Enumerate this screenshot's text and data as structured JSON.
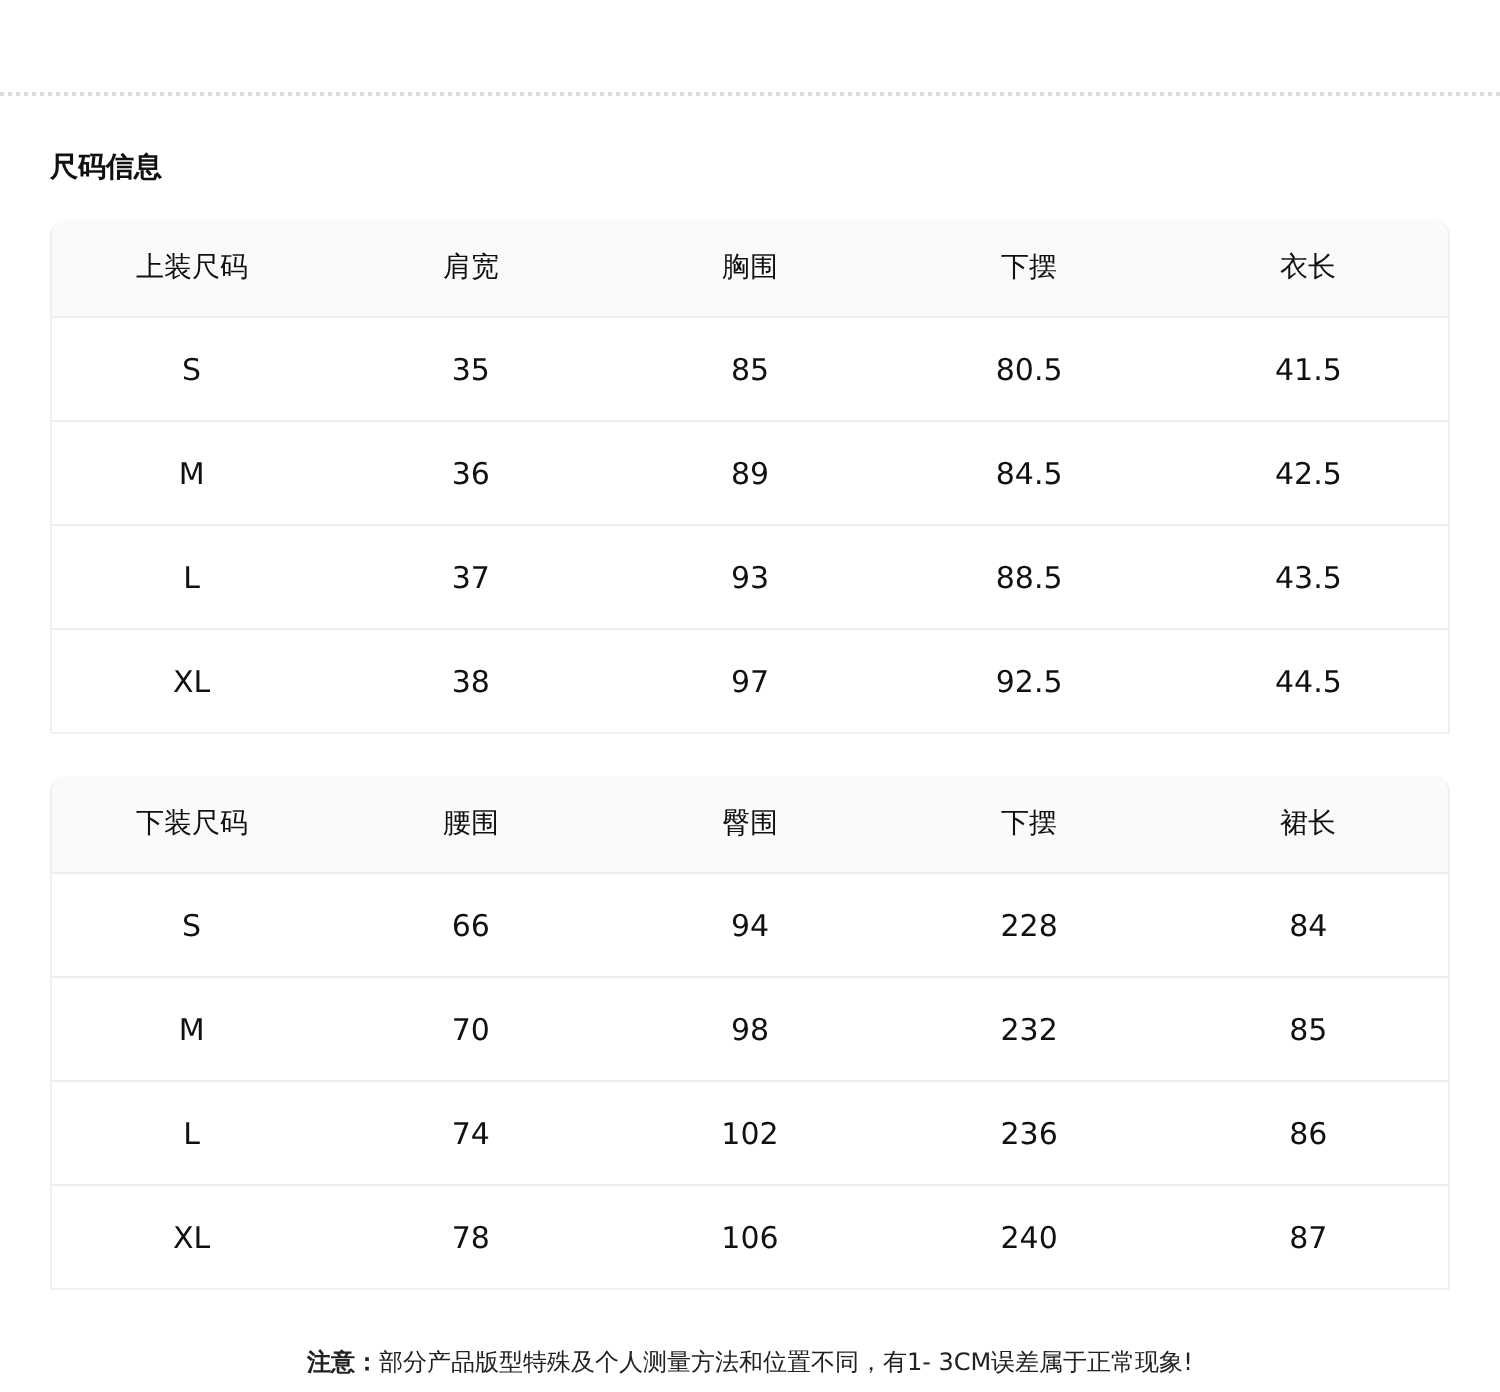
{
  "title": "尺码信息",
  "tables": [
    {
      "columns": [
        "上装尺码",
        "肩宽",
        "胸围",
        "下摆",
        "衣长"
      ],
      "rows": [
        [
          "S",
          "35",
          "85",
          "80.5",
          "41.5"
        ],
        [
          "M",
          "36",
          "89",
          "84.5",
          "42.5"
        ],
        [
          "L",
          "37",
          "93",
          "88.5",
          "43.5"
        ],
        [
          "XL",
          "38",
          "97",
          "92.5",
          "44.5"
        ]
      ]
    },
    {
      "columns": [
        "下装尺码",
        "腰围",
        "臀围",
        "下摆",
        "裙长"
      ],
      "rows": [
        [
          "S",
          "66",
          "94",
          "228",
          "84"
        ],
        [
          "M",
          "70",
          "98",
          "232",
          "85"
        ],
        [
          "L",
          "74",
          "102",
          "236",
          "86"
        ],
        [
          "XL",
          "78",
          "106",
          "240",
          "87"
        ]
      ]
    }
  ],
  "note": "**注意：**部分产品版型特殊及个人测量方法和位置不同，有1- 3CM误差属于正常现象!"
}
